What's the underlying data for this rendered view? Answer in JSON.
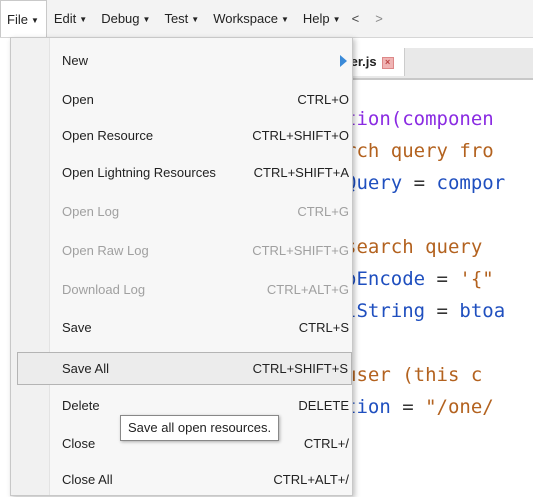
{
  "menubar": {
    "items": [
      {
        "label": "File"
      },
      {
        "label": "Edit"
      },
      {
        "label": "Debug"
      },
      {
        "label": "Test"
      },
      {
        "label": "Workspace"
      },
      {
        "label": "Help"
      }
    ],
    "back": "<",
    "forward": ">"
  },
  "editor": {
    "tab_label": "ler.js",
    "code_lines": [
      [
        "",
        "tion(componen"
      ],
      [
        "rch query fro"
      ],
      [
        "Query",
        " = ",
        "compor"
      ],
      [
        "search query"
      ],
      [
        "oEncode",
        " = ",
        "'{\""
      ],
      [
        "lString",
        " = ",
        "btoa"
      ],
      [
        "user (this c"
      ],
      [
        "tion",
        " = ",
        "\"/one/"
      ]
    ]
  },
  "menu": {
    "items": [
      {
        "label": "New",
        "shortcut": ""
      },
      {
        "label": "Open",
        "shortcut": "CTRL+O"
      },
      {
        "label": "Open Resource",
        "shortcut": "CTRL+SHIFT+O"
      },
      {
        "label": "Open Lightning Resources",
        "shortcut": "CTRL+SHIFT+A"
      },
      {
        "label": "Open Log",
        "shortcut": "CTRL+G"
      },
      {
        "label": "Open Raw Log",
        "shortcut": "CTRL+SHIFT+G"
      },
      {
        "label": "Download Log",
        "shortcut": "CTRL+ALT+G"
      },
      {
        "label": "Save",
        "shortcut": "CTRL+S"
      },
      {
        "label": "Save All",
        "shortcut": "CTRL+SHIFT+S"
      },
      {
        "label": "Delete",
        "shortcut": "DELETE"
      },
      {
        "label": "Close",
        "shortcut": "CTRL+/"
      },
      {
        "label": "Close All",
        "shortcut": "CTRL+ALT+/"
      }
    ]
  },
  "tooltip": {
    "text": "Save all open resources."
  },
  "colors": {
    "submenu_arrow": "#3b8ad8",
    "function_keyword": "#8a2be2",
    "comment": "#b3621f",
    "identifier": "#1f4fbf"
  }
}
